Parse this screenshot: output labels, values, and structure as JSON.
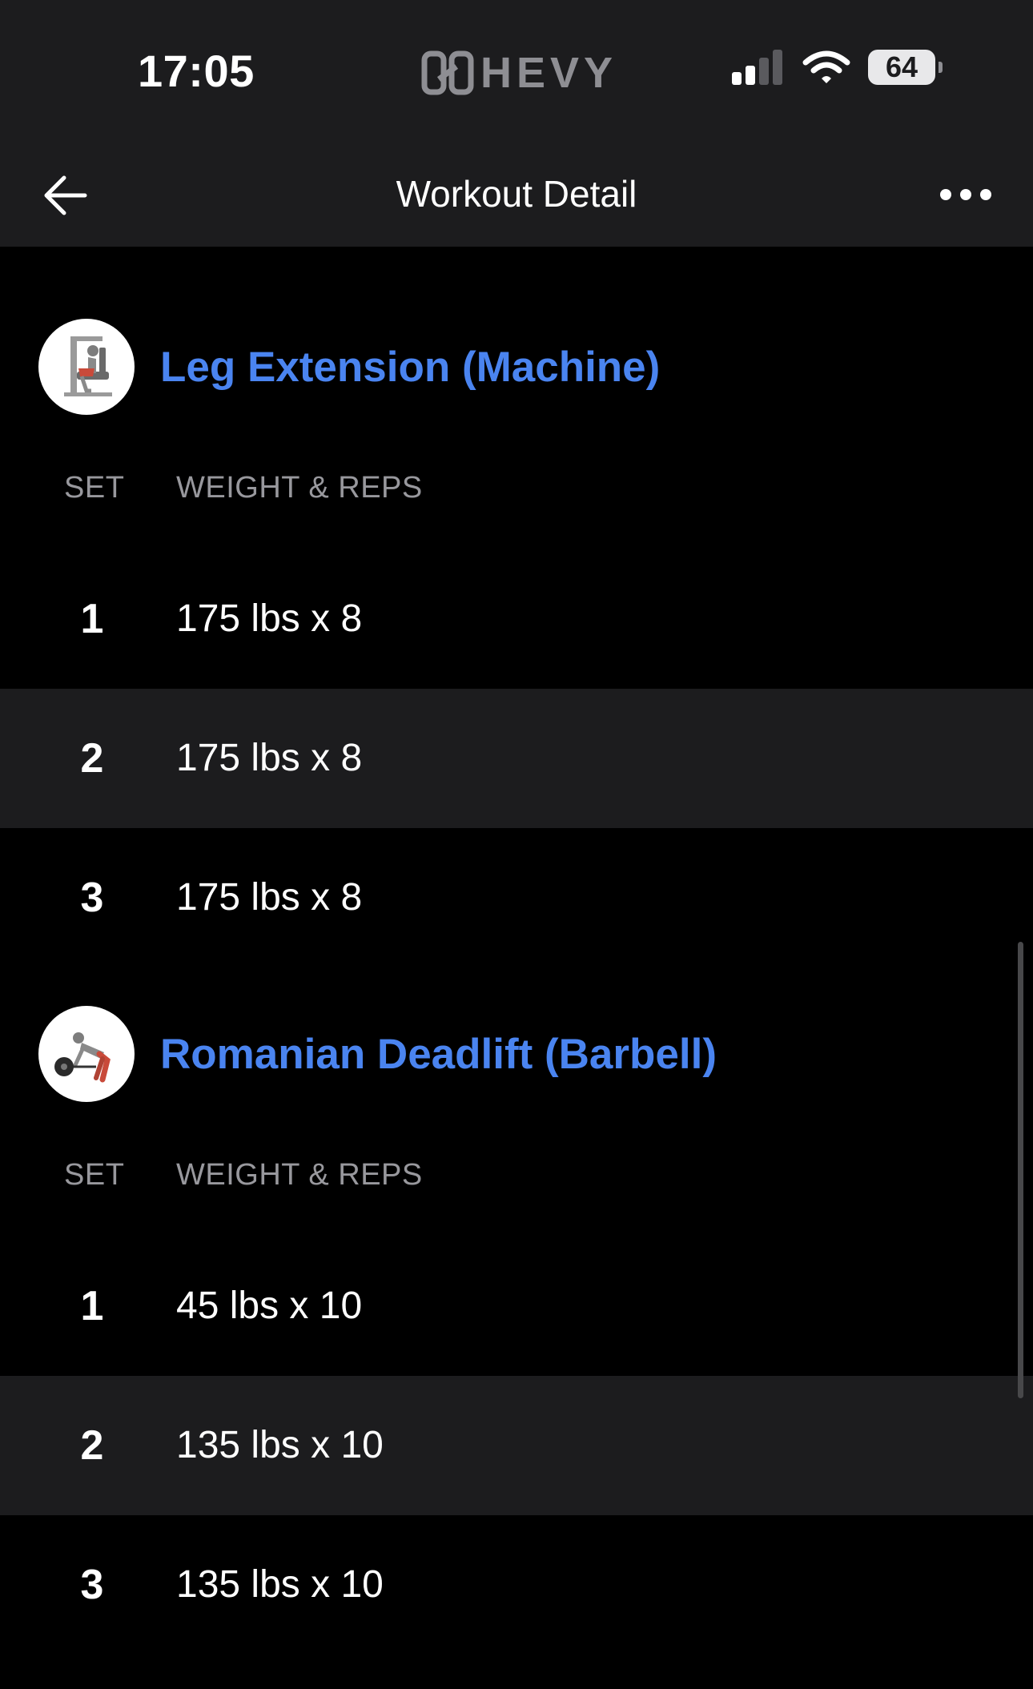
{
  "status": {
    "time": "17:05",
    "brand": "HEVY",
    "battery": "64"
  },
  "header": {
    "title": "Workout Detail"
  },
  "columns": {
    "set": "SET",
    "weight_reps": "WEIGHT & REPS"
  },
  "exercises": [
    {
      "name": "Leg Extension (Machine)",
      "sets": [
        {
          "num": "1",
          "value": "175 lbs x 8"
        },
        {
          "num": "2",
          "value": "175 lbs x 8"
        },
        {
          "num": "3",
          "value": "175 lbs x 8"
        }
      ]
    },
    {
      "name": "Romanian Deadlift (Barbell)",
      "sets": [
        {
          "num": "1",
          "value": "45 lbs x 10"
        },
        {
          "num": "2",
          "value": "135 lbs x 10"
        },
        {
          "num": "3",
          "value": "135 lbs x 10"
        }
      ]
    }
  ],
  "colors": {
    "accent": "#4a84f0",
    "background": "#000000",
    "bar": "#1c1c1e"
  }
}
